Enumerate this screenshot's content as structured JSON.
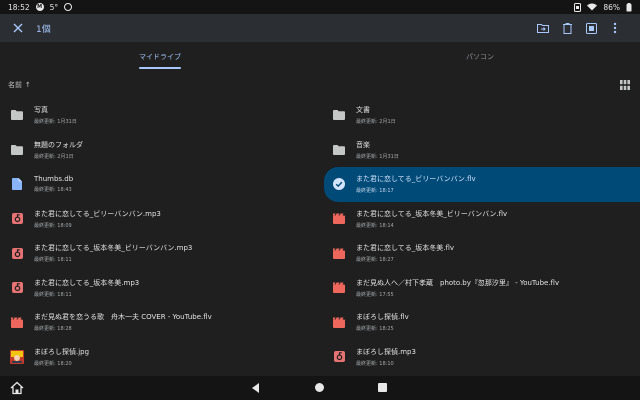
{
  "status_bar": {
    "time": "18:52",
    "temperature": "5°",
    "battery": "86%"
  },
  "toolbar": {
    "selection_count": "1個",
    "actions": [
      "move-to-folder-icon",
      "delete-icon",
      "select-all-icon",
      "more-vert-icon"
    ]
  },
  "tabs": [
    {
      "label": "マイドライブ",
      "active": true
    },
    {
      "label": "パソコン",
      "active": false
    }
  ],
  "sort": {
    "label": "名前",
    "direction": "↑"
  },
  "colors": {
    "accent": "#a8c7fa",
    "selected_bg": "#004a77",
    "folder": "#c4c7c5",
    "audio_red": "#e57373",
    "video_red": "#ee675c",
    "doc_blue": "#8ab4f8",
    "background": "#1f1f1f"
  },
  "files": [
    {
      "name": "写真",
      "meta": "最終更新: 1月31日",
      "type": "folder"
    },
    {
      "name": "文書",
      "meta": "最終更新: 2月1日",
      "type": "folder"
    },
    {
      "name": "無題のフォルダ",
      "meta": "最終更新: 2月1日",
      "type": "folder"
    },
    {
      "name": "音楽",
      "meta": "最終更新: 1月31日",
      "type": "folder"
    },
    {
      "name": "Thumbs.db",
      "meta": "最終更新: 18:43",
      "type": "doc"
    },
    {
      "name": "また君に恋してる_ビリーバンバン.flv",
      "meta": "最終更新: 18:17",
      "type": "video",
      "selected": true
    },
    {
      "name": "また君に恋してる_ビリーバンバン.mp3",
      "meta": "最終更新: 18:09",
      "type": "audio"
    },
    {
      "name": "また君に恋してる_坂本冬美_ビリーバンバン.flv",
      "meta": "最終更新: 18:14",
      "type": "video"
    },
    {
      "name": "また君に恋してる_坂本冬美_ビリーバンバン.mp3",
      "meta": "最終更新: 18:11",
      "type": "audio"
    },
    {
      "name": "また君に恋してる_坂本冬美.flv",
      "meta": "最終更新: 18:27",
      "type": "video"
    },
    {
      "name": "また君に恋してる_坂本冬美.mp3",
      "meta": "最終更新: 18:11",
      "type": "audio"
    },
    {
      "name": "まだ見ぬ人へ／村下孝蔵　photo.by『忽那汐里』 - YouTube.flv",
      "meta": "最終更新: 17:55",
      "type": "video"
    },
    {
      "name": "まだ見ぬ君を恋うる歌　舟木一夫 COVER - YouTube.flv",
      "meta": "最終更新: 18:28",
      "type": "video"
    },
    {
      "name": "まぼろし探偵.flv",
      "meta": "最終更新: 18:25",
      "type": "video"
    },
    {
      "name": "まぼろし探偵.jpg",
      "meta": "最終更新: 18:20",
      "type": "image"
    },
    {
      "name": "まぼろし探偵.mp3",
      "meta": "最終更新: 18:10",
      "type": "audio"
    }
  ]
}
